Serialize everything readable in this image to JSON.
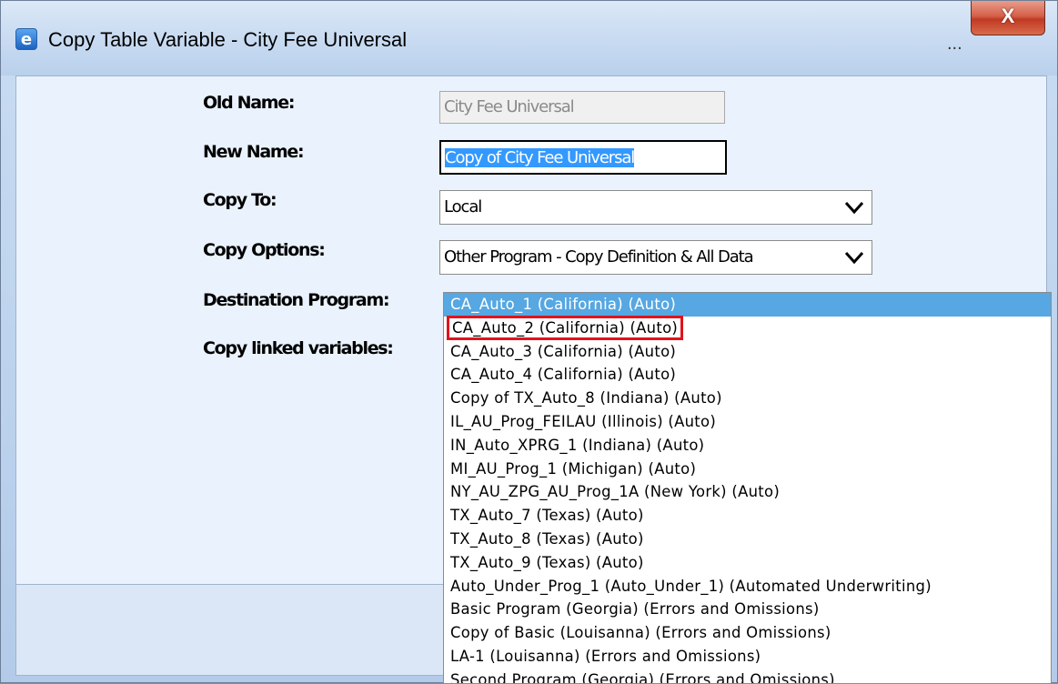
{
  "window": {
    "title": "Copy Table Variable - City Fee Universal",
    "dots": "...",
    "close_label": "X"
  },
  "form": {
    "old_name_label": "Old Name:",
    "old_name_value": "City Fee Universal",
    "new_name_label": "New Name:",
    "new_name_value": "Copy of City Fee Universal",
    "copy_to_label": "Copy To:",
    "copy_to_value": "Local",
    "copy_options_label": "Copy Options:",
    "copy_options_value": "Other Program - Copy Definition & All Data",
    "destination_label": "Destination Program:",
    "linked_label": "Copy linked variables:"
  },
  "destination_list": {
    "options": [
      "CA_Auto_1 (California) (Auto)",
      "CA_Auto_2 (California) (Auto)",
      "CA_Auto_3 (California) (Auto)",
      "CA_Auto_4 (California) (Auto)",
      "Copy of TX_Auto_8 (Indiana) (Auto)",
      "IL_AU_Prog_FEILAU (Illinois) (Auto)",
      "IN_Auto_XPRG_1 (Indiana) (Auto)",
      "MI_AU_Prog_1 (Michigan) (Auto)",
      "NY_AU_ZPG_AU_Prog_1A (New York) (Auto)",
      "TX_Auto_7 (Texas) (Auto)",
      "TX_Auto_8 (Texas) (Auto)",
      "TX_Auto_9 (Texas) (Auto)",
      "Auto_Under_Prog_1 (Auto_Under_1) (Automated Underwriting)",
      "Basic Program (Georgia) (Errors and Omissions)",
      "Copy of Basic (Louisanna) (Errors and Omissions)",
      "LA-1 (Louisanna) (Errors and Omissions)",
      "Second Program (Georgia) (Errors and Omissions)"
    ],
    "selected_index": 0,
    "highlighted_index": 1
  },
  "colors": {
    "selection_blue": "#56a7e2",
    "highlight_red": "#e0141e",
    "close_red": "#c03a22"
  }
}
